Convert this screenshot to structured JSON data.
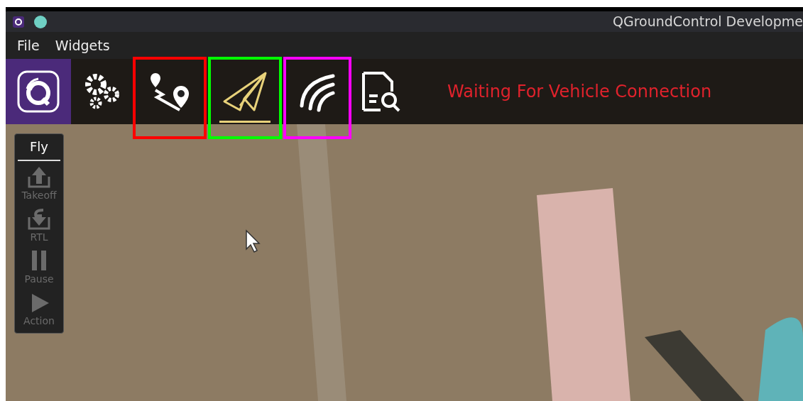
{
  "window": {
    "title": "QGroundControl Developme"
  },
  "menu": [
    "File",
    "Widgets"
  ],
  "toolbar": {
    "tools": [
      {
        "kind": "logo",
        "selected": false
      },
      {
        "kind": "settings",
        "selected": false
      },
      {
        "kind": "plan",
        "selected": false,
        "color": "#ff0000"
      },
      {
        "kind": "fly",
        "selected": true,
        "color": "#00ff00"
      },
      {
        "kind": "comm",
        "selected": false,
        "color": "#ff00ff"
      },
      {
        "kind": "analyze",
        "selected": false
      }
    ],
    "status": "Waiting For Vehicle Connection"
  },
  "fly_panel": {
    "title": "Fly",
    "actions": [
      {
        "kind": "takeoff",
        "label": "Takeoff",
        "disabled": true
      },
      {
        "kind": "rtl",
        "label": "RTL",
        "disabled": true
      },
      {
        "kind": "pause",
        "label": "Pause",
        "disabled": true
      },
      {
        "kind": "action",
        "label": "Action",
        "disabled": true
      }
    ]
  }
}
